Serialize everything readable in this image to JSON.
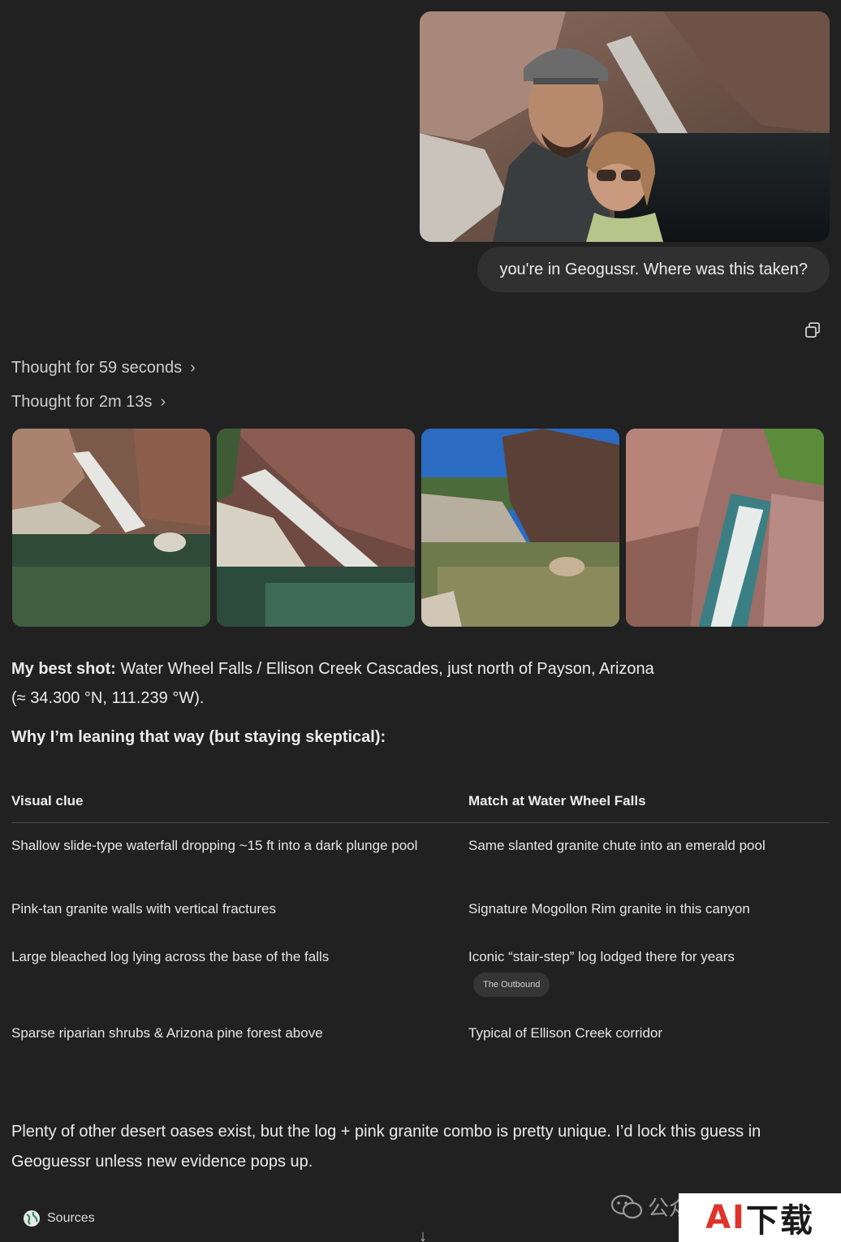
{
  "user": {
    "photo_alt": "selfie-at-waterfall",
    "message": "you're in Geogussr. Where was this taken?"
  },
  "assistant": {
    "copy_icon": "copy-icon",
    "thoughts": [
      {
        "label": "Thought for 59 seconds"
      },
      {
        "label": "Thought for 2m 13s"
      }
    ],
    "gallery": [
      "waterfall-image-1",
      "waterfall-image-2",
      "waterfall-image-3",
      "waterfall-image-4"
    ],
    "best_shot_label": "My best shot:",
    "best_shot_text": " Water Wheel Falls / Ellison Creek Cascades, just north of Payson, Arizona",
    "coords": "(≈ 34.300 °N, 111.239 °W).",
    "why_heading": "Why I’m leaning that way (but staying skeptical):",
    "table": {
      "headers": [
        "Visual clue",
        "Match at Water Wheel Falls"
      ],
      "rows": [
        {
          "clue": "Shallow slide-type waterfall dropping ~15 ft into a dark plunge pool",
          "match": "Same slanted granite chute into an emerald pool",
          "source": ""
        },
        {
          "clue": "Pink-tan granite walls with vertical fractures",
          "match": "Signature Mogollon Rim granite in this canyon",
          "source": ""
        },
        {
          "clue": "Large bleached log lying across the base of the falls",
          "match": "Iconic “stair-step” log lodged there for years",
          "source": "The Outbound"
        },
        {
          "clue": "Sparse riparian shrubs & Arizona pine forest above",
          "match": "Typical of Ellison Creek corridor",
          "source": ""
        }
      ]
    },
    "closing": "Plenty of other desert oases exist, but the log + pink granite combo is pretty unique. I’d lock this guess in Geoguessr unless new evidence pops up.",
    "sources_label": "Sources",
    "scroll_down_glyph": "↓"
  },
  "watermark": {
    "text": "公众",
    "brand_ai": "AI",
    "brand_xz": "下载"
  }
}
